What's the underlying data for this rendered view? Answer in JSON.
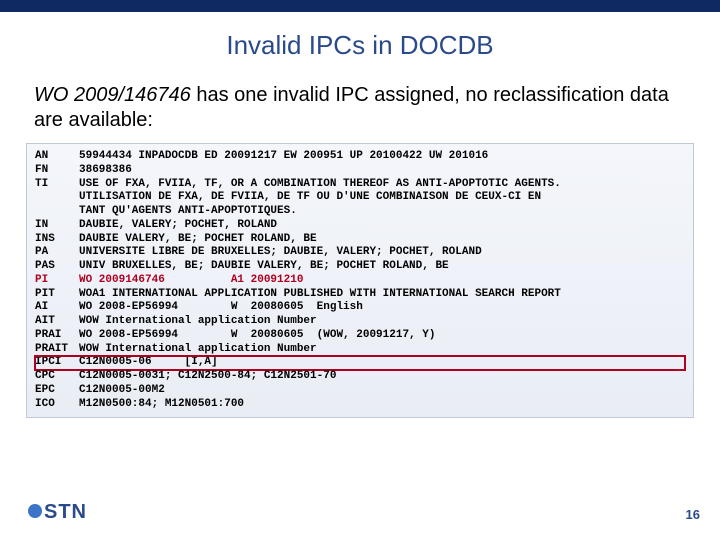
{
  "title": "Invalid IPCs in DOCDB",
  "intro": {
    "docid": "WO 2009/146746",
    "rest": " has one invalid IPC assigned, no reclassification data are available:"
  },
  "record": [
    {
      "tag": "AN",
      "val": "59944434 INPADOCDB ED 20091217 EW 200951 UP 20100422 UW 201016"
    },
    {
      "tag": "FN",
      "val": "38698386"
    },
    {
      "tag": "TI",
      "val": "USE OF FXA, FVIIA, TF, OR A COMBINATION THEREOF AS ANTI-APOPTOTIC AGENTS."
    },
    {
      "tag": "",
      "val": "UTILISATION DE FXA, DE FVIIA, DE TF OU D'UNE COMBINAISON DE CEUX-CI EN"
    },
    {
      "tag": "",
      "val": "TANT QU'AGENTS ANTI-APOPTOTIQUES."
    },
    {
      "tag": "IN",
      "val": "DAUBIE, VALERY; POCHET, ROLAND"
    },
    {
      "tag": "INS",
      "val": "DAUBIE VALERY, BE; POCHET ROLAND, BE"
    },
    {
      "tag": "PA",
      "val": "UNIVERSITE LIBRE DE BRUXELLES; DAUBIE, VALERY; POCHET, ROLAND"
    },
    {
      "tag": "PAS",
      "val": "UNIV BRUXELLES, BE; DAUBIE VALERY, BE; POCHET ROLAND, BE"
    },
    {
      "tag": "PI",
      "val": "WO 2009146746          A1 20091210",
      "style": "pi"
    },
    {
      "tag": "PIT",
      "val": "WOA1 INTERNATIONAL APPLICATION PUBLISHED WITH INTERNATIONAL SEARCH REPORT"
    },
    {
      "tag": "AI",
      "val": "WO 2008-EP56994        W  20080605  English"
    },
    {
      "tag": "AIT",
      "val": "WOW International application Number"
    },
    {
      "tag": "PRAI",
      "val": "WO 2008-EP56994        W  20080605  (WOW, 20091217, Y)"
    },
    {
      "tag": "PRAIT",
      "val": "WOW International application Number"
    },
    {
      "tag": "IPCI",
      "val": "C12N0005-06     [I,A]",
      "style": "highlight-box"
    },
    {
      "tag": "CPC",
      "val": "C12N0005-0031; C12N2500-84; C12N2501-70"
    },
    {
      "tag": "EPC",
      "val": "C12N0005-00M2"
    },
    {
      "tag": "ICO",
      "val": "M12N0500:84; M12N0501:700"
    }
  ],
  "logo_text": "STN",
  "page_number": "16"
}
